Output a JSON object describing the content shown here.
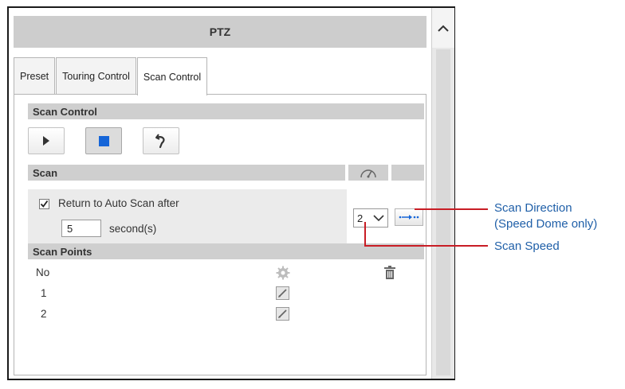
{
  "panel": {
    "title": "PTZ",
    "tabs": [
      {
        "label": "Preset",
        "active": false
      },
      {
        "label": "Touring Control",
        "active": false
      },
      {
        "label": "Scan Control",
        "active": true
      }
    ]
  },
  "scan_control": {
    "header": "Scan Control",
    "buttons": [
      {
        "name": "play",
        "icon": "play-icon",
        "selected": false
      },
      {
        "name": "stop",
        "icon": "stop-icon",
        "selected": true
      },
      {
        "name": "return",
        "icon": "return-icon",
        "selected": false
      }
    ]
  },
  "scan": {
    "header": "Scan",
    "speed_icon": "speedometer-icon",
    "return_auto_scan_checked": true,
    "return_auto_scan_label": "Return to Auto Scan after",
    "seconds_value": "5",
    "seconds_unit": "second(s)",
    "speed_value": "2",
    "direction_icon": "scan-direction-icon"
  },
  "scan_points": {
    "header": "Scan Points",
    "col_no": "No",
    "settings_icon": "gear-icon",
    "delete_icon": "trash-icon",
    "rows": [
      {
        "no": "1",
        "edit_icon": "edit-icon"
      },
      {
        "no": "2",
        "edit_icon": "edit-icon"
      }
    ]
  },
  "callouts": {
    "direction": "Scan Direction\n(Speed Dome only)",
    "direction_line1": "Scan Direction",
    "direction_line2": "(Speed Dome only)",
    "speed": "Scan Speed"
  },
  "colors": {
    "callout_line": "#c81d25",
    "callout_text": "#1f5fa8",
    "stop_icon": "#1565d8",
    "section_bar": "#cfcfcf"
  }
}
